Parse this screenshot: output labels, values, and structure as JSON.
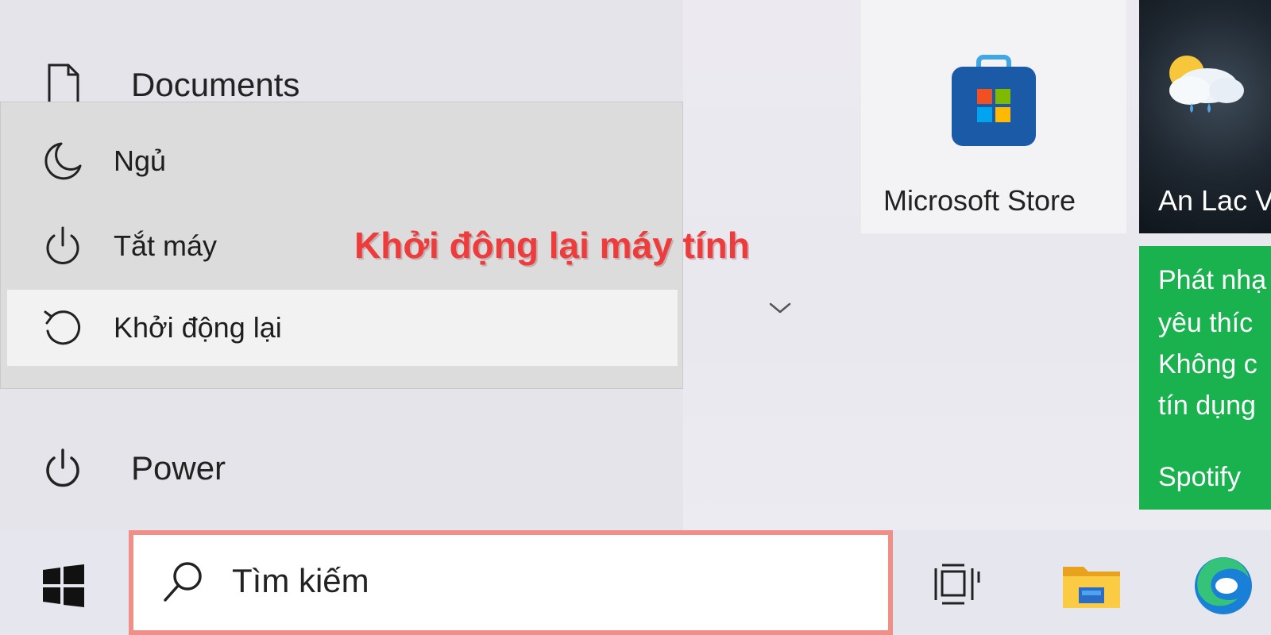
{
  "start_menu": {
    "documents": {
      "label": "Documents",
      "icon": "document-icon"
    },
    "power": {
      "label": "Power",
      "icon": "power-icon"
    }
  },
  "power_flyout": {
    "items": [
      {
        "label": "Ngủ",
        "icon": "moon-icon"
      },
      {
        "label": "Tắt máy",
        "icon": "power-icon"
      },
      {
        "label": "Khởi động lại",
        "icon": "restart-icon",
        "highlighted": true
      }
    ]
  },
  "annotation": {
    "text": "Khởi động lại máy tính",
    "color": "#ee3b3b"
  },
  "tiles": {
    "store": {
      "label": "Microsoft Store"
    },
    "weather": {
      "label": "An Lac V"
    },
    "spotify": {
      "promo_lines": [
        "Phát nhạ",
        "yêu thíc",
        "Không c",
        "tín dụng"
      ],
      "label": "Spotify",
      "color": "#1ab24f"
    }
  },
  "taskbar": {
    "search": {
      "text": "Tìm kiếm",
      "border_color": "#f08e88"
    },
    "icons": [
      "windows-start-icon",
      "task-view-icon",
      "file-explorer-icon",
      "edge-icon"
    ]
  }
}
